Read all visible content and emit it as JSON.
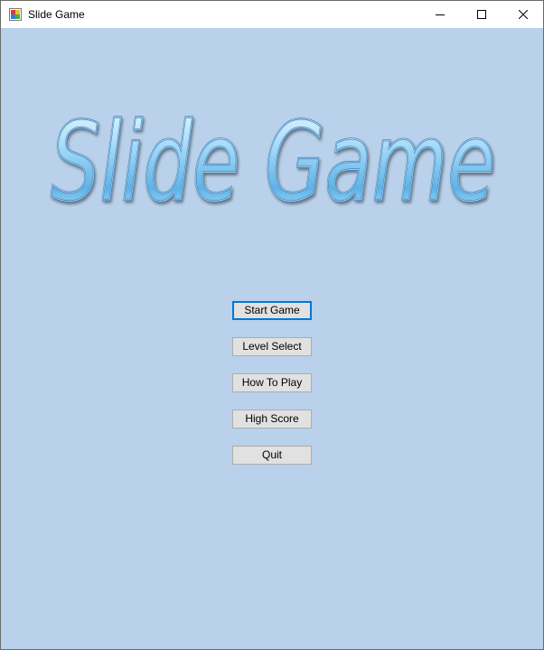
{
  "window": {
    "title": "Slide Game",
    "background": "#b9d1ea",
    "controls": {
      "minimize_icon": "minimize-icon",
      "maximize_icon": "maximize-icon",
      "close_icon": "close-icon"
    }
  },
  "logo": {
    "text": "Slide Game",
    "style": "glossy water-drop lettering",
    "colors": [
      "#e6f6ff",
      "#7cc4f0",
      "#2a86c8"
    ]
  },
  "menu": {
    "buttons": [
      {
        "label": "Start Game",
        "focused": true
      },
      {
        "label": "Level Select",
        "focused": false
      },
      {
        "label": "How To Play",
        "focused": false
      },
      {
        "label": "High Score",
        "focused": false
      },
      {
        "label": "Quit",
        "focused": false
      }
    ]
  }
}
